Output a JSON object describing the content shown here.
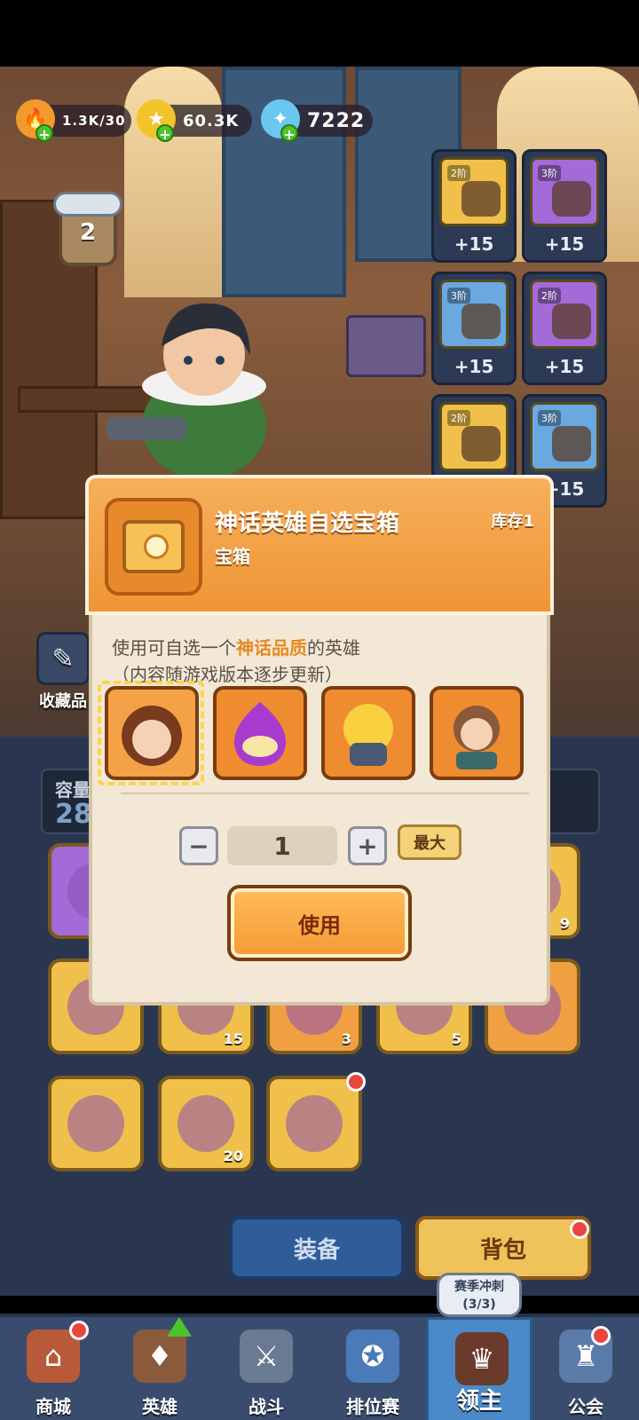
{
  "resources": [
    {
      "name": "stamina",
      "value": "1.3K/30",
      "icon": "flame-icon",
      "color": "#f39a2c"
    },
    {
      "name": "gold",
      "value": "60.3K",
      "icon": "coin-icon",
      "color": "#f3c32c"
    },
    {
      "name": "crystal",
      "value": "7222",
      "icon": "crystal-icon",
      "color": "#6ac8f0"
    }
  ],
  "rank_level": "2",
  "equipment": [
    {
      "tier": "2阶",
      "bonus": "+15",
      "color": "#f0c04a"
    },
    {
      "tier": "3阶",
      "bonus": "+15",
      "color": "#a46ad8"
    },
    {
      "tier": "3阶",
      "bonus": "+15",
      "color": "#6aa8e0"
    },
    {
      "tier": "2阶",
      "bonus": "+15",
      "color": "#a46ad8"
    },
    {
      "tier": "2阶",
      "bonus": "+15",
      "color": "#f0c04a"
    },
    {
      "tier": "3阶",
      "bonus": "+15",
      "color": "#6aa8e0"
    }
  ],
  "collection_label": "收藏品",
  "capacity": {
    "label": "容量",
    "value": "28"
  },
  "bag_items": [
    {
      "count": "",
      "color": "#a46ad8"
    },
    {
      "count": "9",
      "color": "#f0c04a"
    },
    {
      "count": "",
      "color": "#f0c04a"
    },
    {
      "count": "15",
      "color": "#f0c04a"
    },
    {
      "count": "3",
      "color": "#f0a040"
    },
    {
      "count": "5",
      "color": "#f0c04a"
    },
    {
      "count": "",
      "color": "#f0a040"
    },
    {
      "count": "",
      "color": "#f0c04a"
    },
    {
      "count": "20",
      "color": "#f0c04a"
    },
    {
      "count": "",
      "color": "#f0c04a"
    }
  ],
  "tabs": {
    "equip": "装备",
    "bag": "背包"
  },
  "season_bubble": {
    "line1": "赛季冲刺",
    "line2": "(3/3)"
  },
  "nav": [
    "商城",
    "英雄",
    "战斗",
    "排位赛",
    "领主",
    "公会"
  ],
  "modal": {
    "title": "神话英雄自选宝箱",
    "subtitle": "宝箱",
    "stock": "库存1",
    "desc_prefix": "使用可自选一个",
    "desc_highlight": "神话品质",
    "desc_suffix": "的英雄",
    "desc_line2": "（内容随游戏版本逐步更新）",
    "quantity": "1",
    "minus": "−",
    "plus": "+",
    "max_label": "最大",
    "use_label": "使用"
  }
}
